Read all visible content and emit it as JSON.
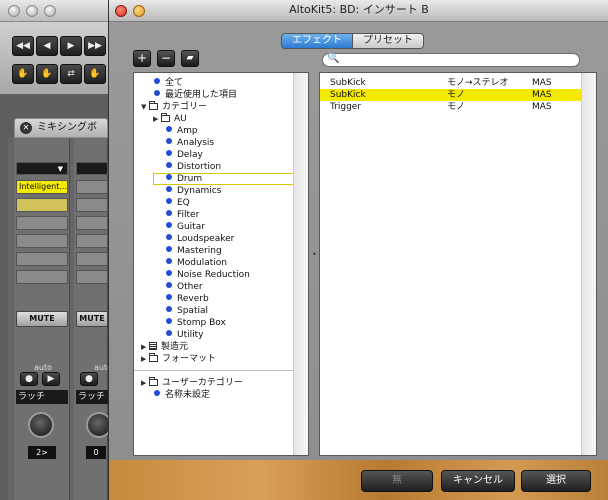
{
  "dialog": {
    "title": "AltoKit5: BD: インサート B",
    "tabs": [
      {
        "label": "エフェクト"
      },
      {
        "label": "プリセット"
      }
    ],
    "tree": [
      {
        "label": "全て"
      },
      {
        "label": "最近使用した項目"
      },
      {
        "label": "カテゴリー"
      },
      {
        "label": "AU"
      },
      {
        "label": "Amp"
      },
      {
        "label": "Analysis"
      },
      {
        "label": "Delay"
      },
      {
        "label": "Distortion"
      },
      {
        "label": "Drum"
      },
      {
        "label": "Dynamics"
      },
      {
        "label": "EQ"
      },
      {
        "label": "Filter"
      },
      {
        "label": "Guitar"
      },
      {
        "label": "Loudspeaker"
      },
      {
        "label": "Mastering"
      },
      {
        "label": "Modulation"
      },
      {
        "label": "Noise Reduction"
      },
      {
        "label": "Other"
      },
      {
        "label": "Reverb"
      },
      {
        "label": "Spatial"
      },
      {
        "label": "Stomp Box"
      },
      {
        "label": "Utility"
      },
      {
        "label": "製造元"
      },
      {
        "label": "フォーマット"
      },
      {
        "label": "ユーザーカテゴリー"
      },
      {
        "label": "名称未設定"
      }
    ],
    "effects": [
      {
        "name": "SubKick",
        "channels": "モノ→ステレオ",
        "format": "MAS"
      },
      {
        "name": "SubKick",
        "channels": "モノ",
        "format": "MAS"
      },
      {
        "name": "Trigger",
        "channels": "モノ",
        "format": "MAS"
      }
    ],
    "buttons": {
      "none": "無",
      "cancel": "キャンセル",
      "select": "選択"
    }
  },
  "mixer": {
    "tab_label": "ミキシングボ",
    "insert_label": "Intelligent...",
    "mute_label": "MUTE",
    "auto_label": "auto",
    "latch_label": "ラッチ",
    "pan_values": [
      "2>",
      "0"
    ]
  }
}
